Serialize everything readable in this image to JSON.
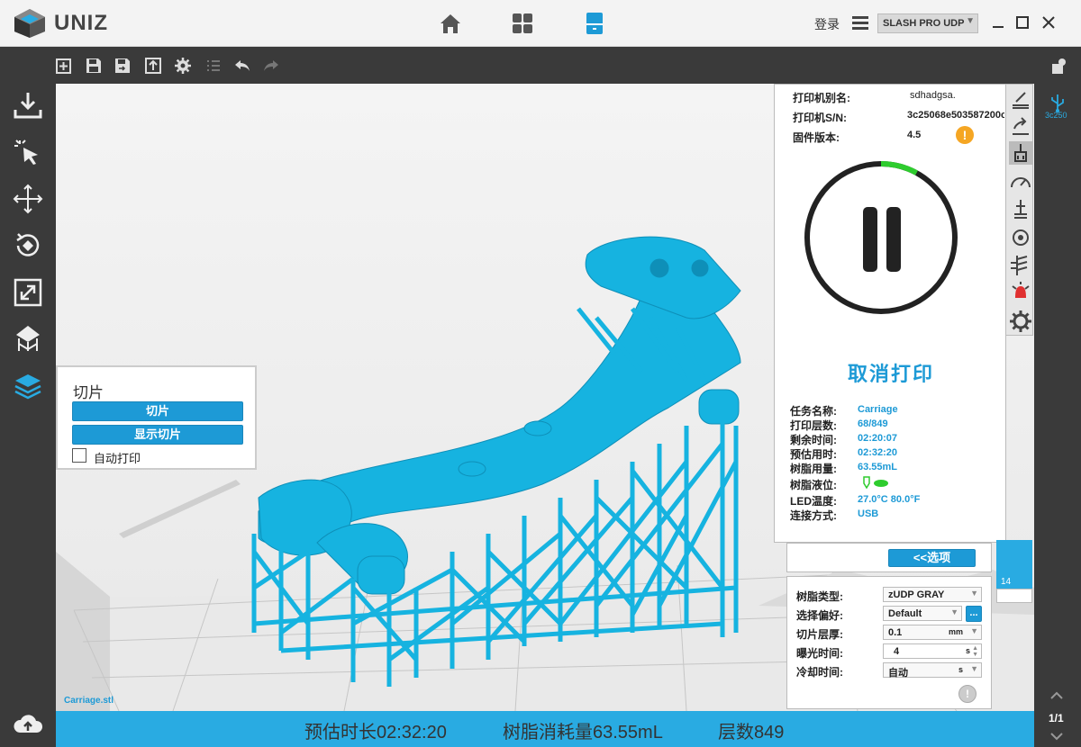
{
  "app": {
    "logo_text": "UNIZ"
  },
  "titlebar": {
    "login_label": "登录",
    "printer_model": "SLASH PRO UDP"
  },
  "printer_info": {
    "alias_label": "打印机别名:",
    "alias_value": "sdhadgsa.",
    "sn_label": "打印机S/N:",
    "sn_value": "3c25068e503587200c",
    "firmware_label": "固件版本:",
    "firmware_value": "4.5",
    "warning_symbol": "!",
    "progress_fraction": 0.08,
    "cancel_print_label": "取消打印",
    "job": [
      {
        "label": "任务名称:",
        "value": "Carriage"
      },
      {
        "label": "打印层数:",
        "value": "68/849"
      },
      {
        "label": "剩余时间:",
        "value": "02:20:07"
      },
      {
        "label": "预估用时:",
        "value": "02:32:20"
      },
      {
        "label": "树脂用量:",
        "value": "63.55mL"
      },
      {
        "label": "树脂液位:",
        "value": ""
      },
      {
        "label": "LED温度:",
        "value": "27.0°C 80.0°F"
      },
      {
        "label": "连接方式:",
        "value": "USB"
      }
    ]
  },
  "slice_panel": {
    "title": "切片",
    "slice_button": "切片",
    "show_slice_button": "显示切片",
    "auto_print_label": "自动打印",
    "auto_print_checked": false
  },
  "options_button": "<<选项",
  "settings": {
    "resin_type_label": "树脂类型:",
    "resin_type_value": "zUDP GRAY",
    "preference_label": "选择偏好:",
    "preference_value": "Default",
    "preference_more": "...",
    "layer_thickness_label": "切片层厚:",
    "layer_thickness_value": "0.1",
    "layer_thickness_unit": "mm",
    "exposure_label": "曝光时间:",
    "exposure_value": "4",
    "exposure_unit": "s",
    "cooling_label": "冷却时间:",
    "cooling_value": "自动",
    "cooling_unit": "s"
  },
  "layer_slider": {
    "current": "14"
  },
  "right_sidebar": {
    "usb_label": "3c250",
    "page_indicator": "1/1"
  },
  "viewport": {
    "file_name": "Carriage.stl"
  },
  "status": {
    "est_time": "预估时长02:32:20",
    "resin_usage": "树脂消耗量63.55mL",
    "layers": "层数849"
  },
  "colors": {
    "accent": "#1d9ad6",
    "model": "#16b3e0",
    "status_bar": "#29abe2",
    "progress": "#2ecc2e",
    "warning": "#f5a623"
  }
}
